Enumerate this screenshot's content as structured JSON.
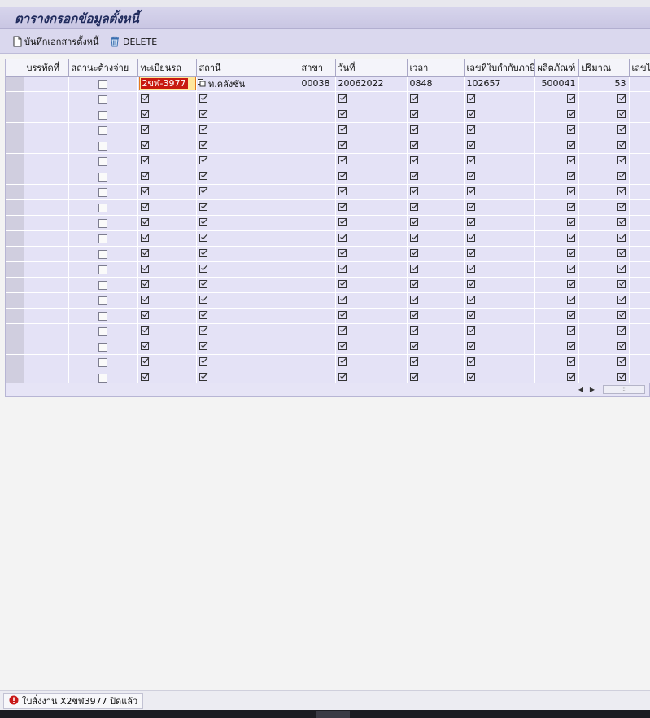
{
  "window": {
    "title": "ตารางกรอกข้อมูลตั้งหนี้"
  },
  "toolbar": {
    "save_doc_label": "บันทึกเอกสารตั้งหนี้",
    "delete_label": "DELETE"
  },
  "grid": {
    "columns": [
      "บรรทัดที่",
      "สถานะต้างจ่าย",
      "ทะเบียนรถ",
      "สถานี",
      "สาขา",
      "วันที่",
      "เวลา",
      "เลขที่ใบกำกับภาษี",
      "ผลิตภัณฑ์",
      "ปริมาณ",
      "เลขไม"
    ],
    "first_row": {
      "line_no": "",
      "vehicle": "2ขฬ-3977",
      "station": "ท.คลังชัน",
      "branch": "00038",
      "date": "20062022",
      "time": "0848",
      "tax_invoice": "102657",
      "product": "500041",
      "quantity": "53"
    },
    "empty_row_count": 19
  },
  "icons": {
    "save_doc": "document-icon",
    "delete": "trash-icon",
    "status_error": "error-icon",
    "cell_check": "check-square-icon",
    "copy": "copy-icon"
  },
  "colors": {
    "title": "#1f2a5c",
    "selected_cell": "#ffe79b",
    "selection_text_bg": "#c8190f",
    "error": "#c81818"
  },
  "status": {
    "message": "ใบสั่งงาน X2ขฬ3977 ปิดแล้ว"
  }
}
